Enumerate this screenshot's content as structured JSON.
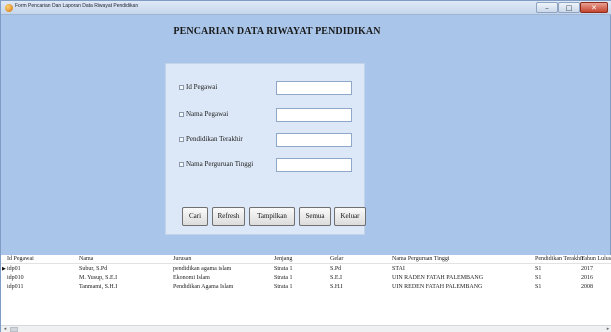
{
  "window": {
    "title": "Form Pencarian Dan Laporan Data Riwayat Pendidikan",
    "controls": {
      "minimize": "–",
      "maximize": "□",
      "close": "✕"
    }
  },
  "heading": "PENCARIAN DATA RIWAYAT PENDIDIKAN",
  "search_fields": [
    {
      "label": "Id Pegawai",
      "value": ""
    },
    {
      "label": "Nama Pegawai",
      "value": ""
    },
    {
      "label": "Pendidikan Terakhir",
      "value": ""
    },
    {
      "label": "Nama Perguruan Tinggi",
      "value": ""
    }
  ],
  "buttons": {
    "cari": "Cari",
    "refresh": "Refresh",
    "tampilkan": "Tampilkan",
    "semua": "Semua",
    "keluar": "Keluar"
  },
  "grid": {
    "columns": [
      "Id Pegawai",
      "Nama",
      "Jurusan",
      "Jenjang",
      "Gelar",
      "Nama Perguruan Tinggi",
      "Pendidikan Terakhir",
      "Tahun Lulus"
    ],
    "rows": [
      [
        "idp01",
        "Subur, S.Pd",
        "pendidikan agama islam",
        "Strata 1",
        "S.Pd",
        "STAI",
        "S1",
        "2017"
      ],
      [
        "idp010",
        "M. Yusup, S.E.I",
        "Ekonomi Islam",
        "Strata 1",
        "S.E.I",
        "UIN RADEN FATAH PALEMBANG",
        "S1",
        "2016"
      ],
      [
        "idp011",
        "Tanmami, S.H.I",
        "Pendidikan Agama Islam",
        "Strata 1",
        "S.H.I",
        "UIN REDEN FATAH PALEMBANG",
        "S1",
        "2008"
      ]
    ],
    "current_row_indicator": "▶"
  },
  "scrollbar": {
    "left_arrow": "◂",
    "right_arrow": "▸"
  }
}
